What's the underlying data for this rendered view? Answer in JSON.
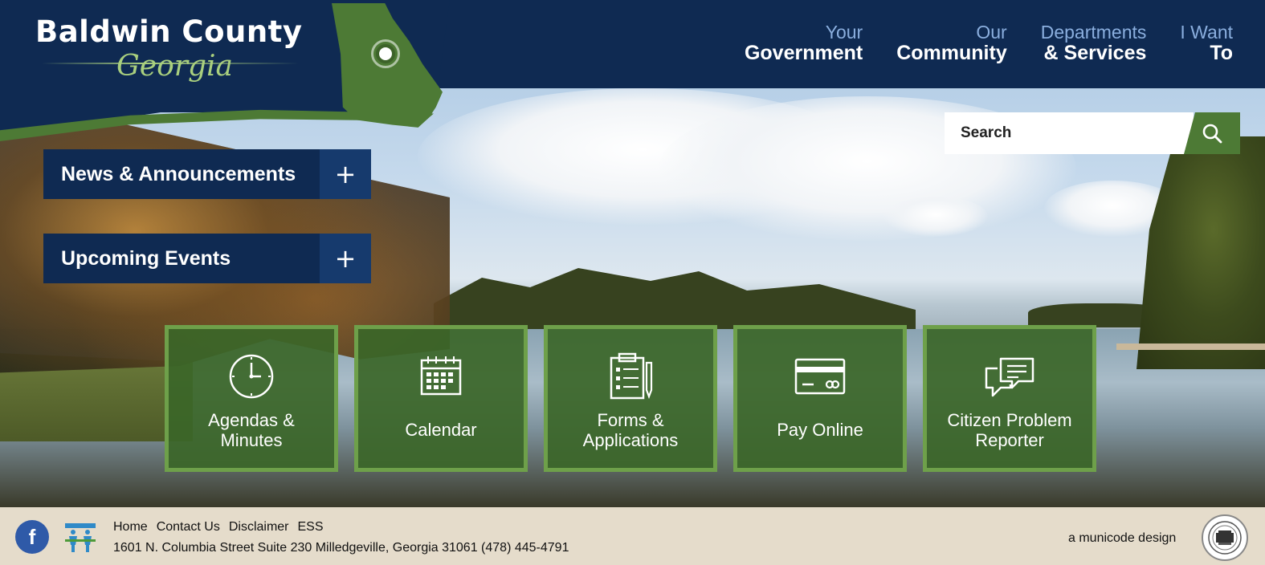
{
  "logo": {
    "title": "Baldwin County",
    "subtitle": "Georgia"
  },
  "nav": [
    {
      "top": "Your",
      "bottom": "Government"
    },
    {
      "top": "Our",
      "bottom": "Community"
    },
    {
      "top": "Departments",
      "bottom": "& Services"
    },
    {
      "top": "I Want",
      "bottom": "To"
    }
  ],
  "search": {
    "placeholder": "Search"
  },
  "accordions": [
    {
      "label": "News & Announcements",
      "toggle": "+"
    },
    {
      "label": "Upcoming Events",
      "toggle": "+"
    }
  ],
  "tiles": [
    {
      "label": "Agendas & Minutes",
      "icon": "clock-icon"
    },
    {
      "label": "Calendar",
      "icon": "calendar-icon"
    },
    {
      "label": "Forms & Applications",
      "icon": "clipboard-icon"
    },
    {
      "label": "Pay Online",
      "icon": "credit-card-icon"
    },
    {
      "label": "Citizen Problem Reporter",
      "icon": "chat-bubbles-icon"
    }
  ],
  "footer": {
    "facebook": "f",
    "links": [
      "Home",
      "Contact Us",
      "Disclaimer",
      "ESS"
    ],
    "address": "1601 N. Columbia Street Suite 230 Milledgeville, Georgia 31061 (478) 445-4791",
    "credit": "a municode design"
  },
  "colors": {
    "navy": "#0f2a52",
    "green": "#4d7a35",
    "tile_border": "#6ea04a",
    "footer_bg": "#e5dccb",
    "nav_accent": "#8aaede"
  }
}
